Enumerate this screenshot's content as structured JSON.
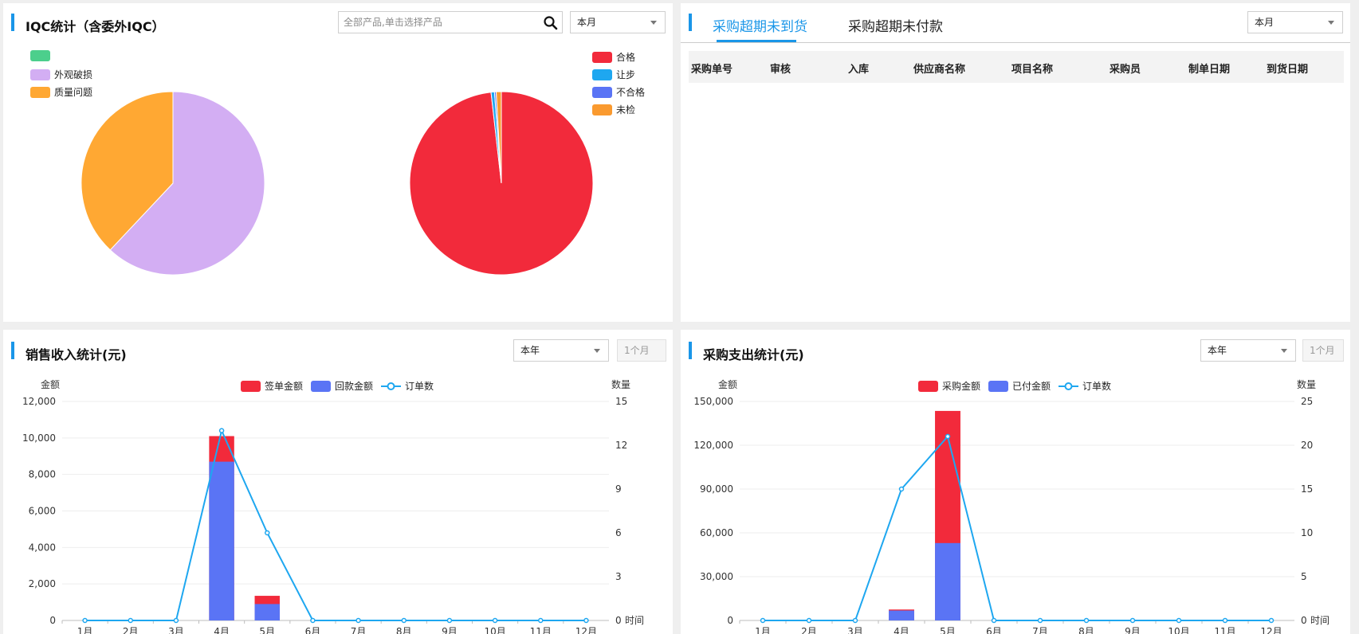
{
  "iqc": {
    "title": "IQC统计（含委外IQC）",
    "search_placeholder": "全部产品,单击选择产品",
    "period": "本月",
    "pie_left_legend": [
      {
        "label": "",
        "color": "#4ccf8c"
      },
      {
        "label": "外观破损",
        "color": "#d3aef3"
      },
      {
        "label": "质量问题",
        "color": "#ffa833"
      }
    ],
    "pie_right_legend": [
      {
        "label": "合格",
        "color": "#f22a3b"
      },
      {
        "label": "让步",
        "color": "#1ea7f0"
      },
      {
        "label": "不合格",
        "color": "#5a74f5"
      },
      {
        "label": "未检",
        "color": "#fa9a2f"
      }
    ]
  },
  "purchase_overdue": {
    "tabs": [
      "采购超期未到货",
      "采购超期未付款"
    ],
    "active_tab": 0,
    "period": "本月",
    "columns": [
      "采购单号",
      "审核",
      "入库",
      "供应商名称",
      "项目名称",
      "采购员",
      "制单日期",
      "到货日期"
    ],
    "rows": []
  },
  "sales": {
    "title": "销售收入统计(元)",
    "period": "本年",
    "range": "1个月"
  },
  "purchase_expense": {
    "title": "采购支出统计(元)",
    "period": "本年",
    "range": "1个月"
  },
  "chart_data": [
    {
      "type": "pie",
      "title": "",
      "labels": [
        "",
        "外观破损",
        "质量问题"
      ],
      "values": [
        0,
        62,
        38
      ],
      "colors": [
        "#4ccf8c",
        "#d3aef3",
        "#ffa833"
      ]
    },
    {
      "type": "pie",
      "title": "",
      "labels": [
        "合格",
        "让步",
        "不合格",
        "未检"
      ],
      "values": [
        98.2,
        0.6,
        0.3,
        0.9
      ],
      "colors": [
        "#f22a3b",
        "#1ea7f0",
        "#5a74f5",
        "#fa9a2f"
      ]
    },
    {
      "type": "bar",
      "stacked": true,
      "categories": [
        "1月",
        "2月",
        "3月",
        "4月",
        "5月",
        "6月",
        "7月",
        "8月",
        "9月",
        "10月",
        "11月",
        "12月"
      ],
      "series": [
        {
          "name": "回款金额",
          "values": [
            0,
            0,
            0,
            8700,
            900,
            0,
            0,
            0,
            0,
            0,
            0,
            0
          ],
          "color": "#5a74f5"
        },
        {
          "name": "签单金额",
          "values": [
            0,
            0,
            0,
            10100,
            1350,
            0,
            0,
            0,
            0,
            0,
            0,
            0
          ],
          "color": "#f22a3b"
        }
      ],
      "line_series": {
        "name": "订单数",
        "values": [
          0,
          0,
          0,
          13,
          6,
          0,
          0,
          0,
          0,
          0,
          0,
          0
        ],
        "color": "#1ea7f0"
      },
      "ylabel_left": "金额",
      "ylabel_right": "数量",
      "xlabel": "时间",
      "ylim_left": [
        0,
        12000
      ],
      "ylim_right": [
        0,
        15
      ],
      "yticks_left": [
        "0",
        "2,000",
        "4,000",
        "6,000",
        "8,000",
        "10,000",
        "12,000"
      ],
      "yticks_right": [
        "0",
        "3",
        "6",
        "9",
        "12",
        "15"
      ],
      "legend": [
        "签单金额",
        "回款金额",
        "订单数"
      ],
      "legend_position": "top-center"
    },
    {
      "type": "bar",
      "stacked": true,
      "categories": [
        "1月",
        "2月",
        "3月",
        "4月",
        "5月",
        "6月",
        "7月",
        "8月",
        "9月",
        "10月",
        "11月",
        "12月"
      ],
      "series": [
        {
          "name": "已付金额",
          "values": [
            0,
            0,
            0,
            6800,
            53000,
            0,
            0,
            0,
            0,
            0,
            0,
            0
          ],
          "color": "#5a74f5"
        },
        {
          "name": "采购金额",
          "values": [
            0,
            0,
            0,
            7500,
            143500,
            0,
            0,
            0,
            0,
            0,
            0,
            0
          ],
          "color": "#f22a3b"
        }
      ],
      "line_series": {
        "name": "订单数",
        "values": [
          0,
          0,
          0,
          15,
          21,
          0,
          0,
          0,
          0,
          0,
          0,
          0
        ],
        "color": "#1ea7f0"
      },
      "ylabel_left": "金额",
      "ylabel_right": "数量",
      "xlabel": "时间",
      "ylim_left": [
        0,
        150000
      ],
      "ylim_right": [
        0,
        25
      ],
      "yticks_left": [
        "0",
        "30,000",
        "60,000",
        "90,000",
        "120,000",
        "150,000"
      ],
      "yticks_right": [
        "0",
        "5",
        "10",
        "15",
        "20",
        "25"
      ],
      "legend": [
        "采购金额",
        "已付金额",
        "订单数"
      ],
      "legend_position": "top-center"
    }
  ]
}
